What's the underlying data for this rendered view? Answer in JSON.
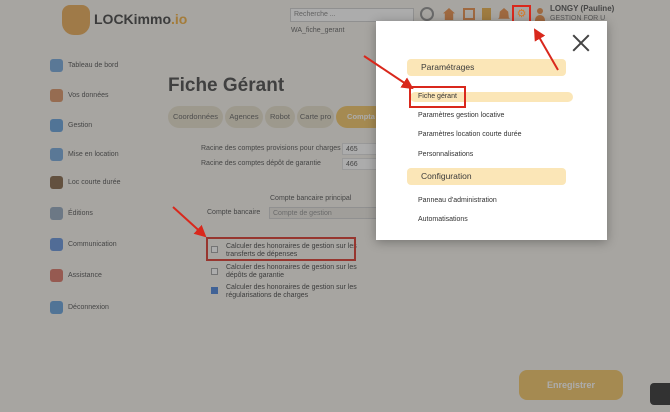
{
  "header": {
    "brand": "LOCKimmo",
    "brand_suffix": ".io",
    "search_placeholder": "Recherche ...",
    "username": "LONGY (Pauline)",
    "company": "GESTION FOR U",
    "breadcrumb": "WA_fiche_gerant"
  },
  "sidebar": {
    "items": [
      {
        "label": "Tableau de bord",
        "icon": "dashboard-icon",
        "color": "#6aa0d8"
      },
      {
        "label": "Vos données",
        "icon": "person-icon",
        "color": "#d88a5a"
      },
      {
        "label": "Gestion",
        "icon": "management-icon",
        "color": "#5a9ad8"
      },
      {
        "label": "Mise en location",
        "icon": "rental-icon",
        "color": "#6aa0d8"
      },
      {
        "label": "Loc courte durée",
        "icon": "short-stay-icon",
        "color": "#7a5a3a"
      },
      {
        "label": "Éditions",
        "icon": "editions-icon",
        "color": "#8aa0b8"
      },
      {
        "label": "Communication",
        "icon": "communication-icon",
        "color": "#5a8ad8"
      },
      {
        "label": "Assistance",
        "icon": "assistance-icon",
        "color": "#d86a5a"
      },
      {
        "label": "Déconnexion",
        "icon": "logout-icon",
        "color": "#5a9ad8"
      }
    ]
  },
  "main": {
    "title": "Fiche Gérant",
    "tabs": [
      "Coordonnées",
      "Agences",
      "Robot",
      "Carte pro",
      "Compta"
    ],
    "rows": [
      {
        "label": "Racine des comptes provisions pour charges",
        "value": "465"
      },
      {
        "label": "Racine des comptes dépôt de garantie",
        "value": "466"
      }
    ],
    "bank_section_title": "Compte bancaire principal",
    "bank_label": "Compte bancaire",
    "bank_value": "Compte de gestion",
    "checkboxes": [
      {
        "label": "Calculer des honoraires de gestion sur les transferts de dépenses",
        "checked": false
      },
      {
        "label": "Calculer des honoraires de gestion sur les dépôts de garantie",
        "checked": false
      },
      {
        "label": "Calculer des honoraires de gestion sur les régularisations de charges",
        "checked": true
      }
    ],
    "save_label": "Enregistrer"
  },
  "modal": {
    "section1": "Paramétrages",
    "section1_items": [
      "Fiche gérant",
      "Paramètres gestion locative",
      "Paramètres location courte durée",
      "Personnalisations"
    ],
    "section2": "Configuration",
    "section2_items": [
      "Panneau d'administration",
      "Automatisations"
    ]
  },
  "colors": {
    "accent": "#f2c25a",
    "annotation_red": "#d9281c",
    "menu_header_bg": "#fbe6b7"
  }
}
